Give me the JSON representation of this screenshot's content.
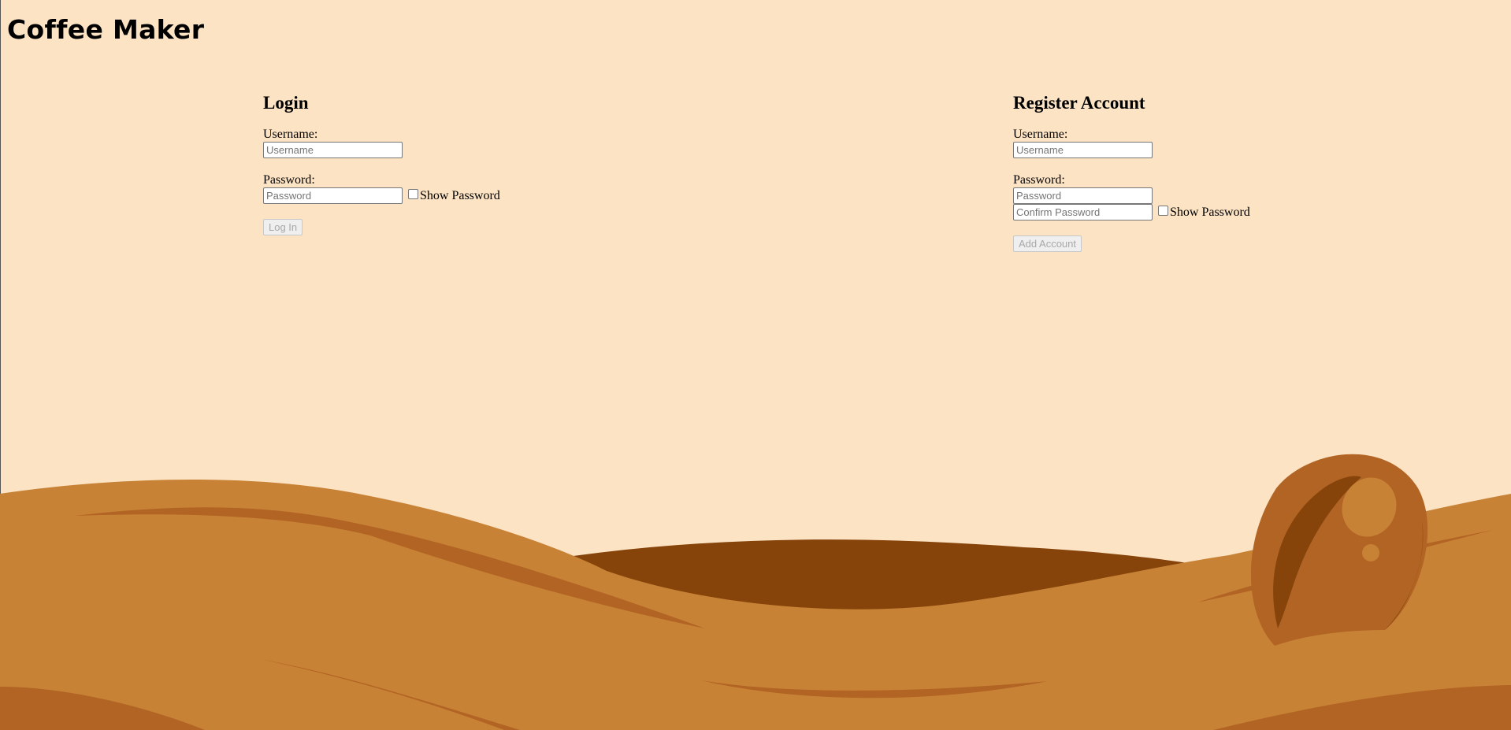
{
  "app": {
    "title": "Coffee Maker"
  },
  "login": {
    "heading": "Login",
    "username_label": "Username:",
    "username_placeholder": "Username",
    "password_label": "Password:",
    "password_placeholder": "Password",
    "show_password_label": "Show Password",
    "submit_label": "Log In"
  },
  "register": {
    "heading": "Register Account",
    "username_label": "Username:",
    "username_placeholder": "Username",
    "password_label": "Password:",
    "password_placeholder": "Password",
    "confirm_password_placeholder": "Confirm Password",
    "show_password_label": "Show Password",
    "submit_label": "Add Account"
  },
  "colors": {
    "background": "#fce3c4",
    "hill_light": "#c88236",
    "hill_mid": "#b16423",
    "hill_dark": "#87440a",
    "bean": "#b16423"
  }
}
